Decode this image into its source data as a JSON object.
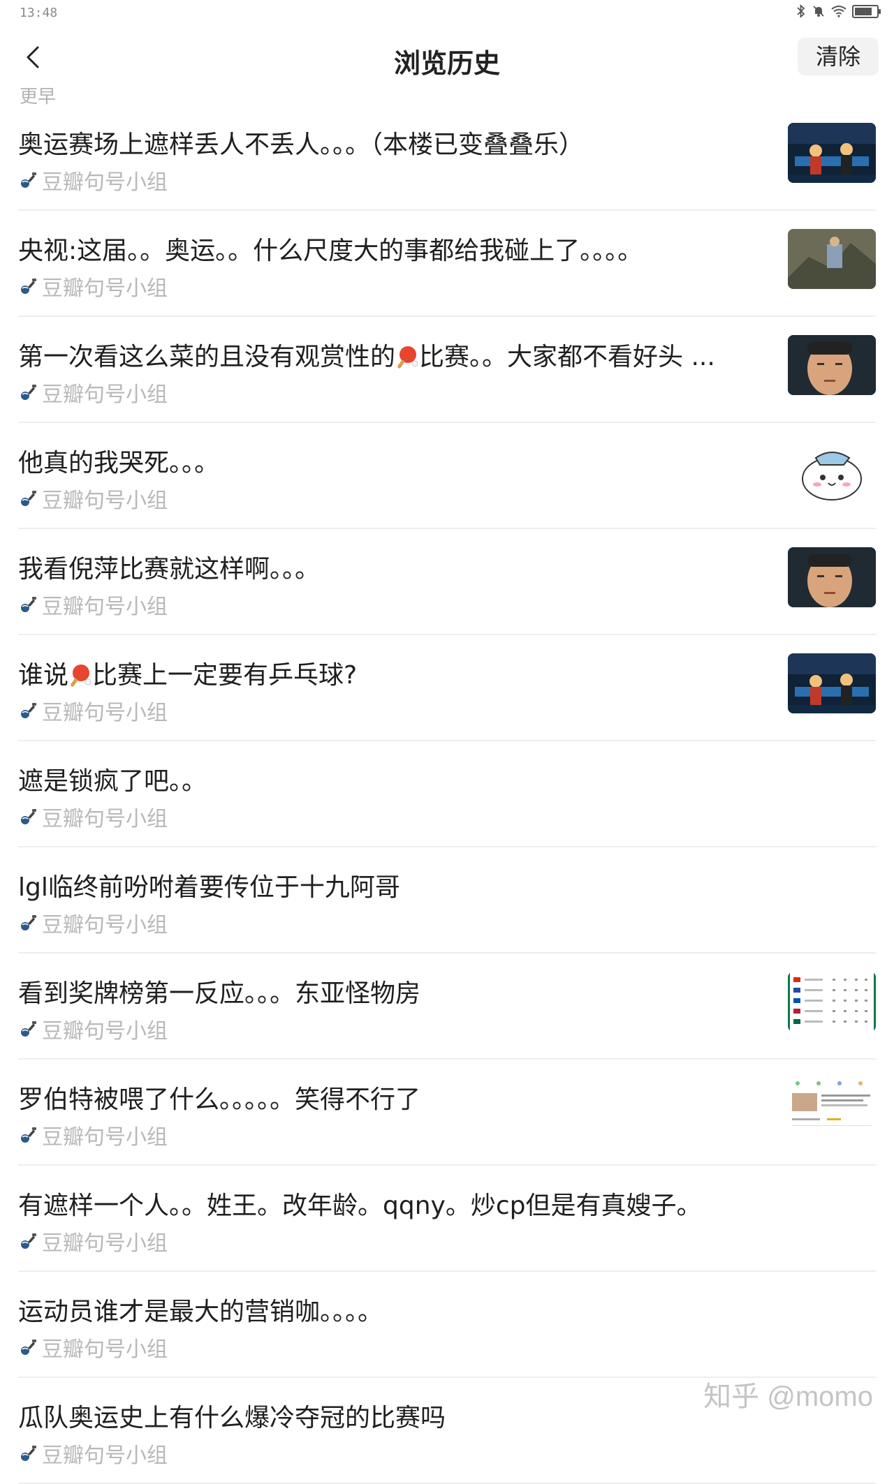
{
  "status_bar": {
    "time": "13:48",
    "icons": [
      "bluetooth-icon",
      "mute-icon",
      "wifi-icon",
      "battery-icon"
    ],
    "battery_level": 0.85
  },
  "header": {
    "title": "浏览历史",
    "clear_label": "清除",
    "back_icon": "back-arrow-icon"
  },
  "section_label": "更早",
  "items": [
    {
      "title": "奥运赛场上遮样丢人不丢人。。。（本楼已变叠叠乐）",
      "group": "豆瓣句号小组",
      "thumb": "table-tennis-match"
    },
    {
      "title": "央视:这届。。奥运。。什么尺度大的事都给我碰上了。。。。",
      "group": "豆瓣句号小组",
      "thumb": "rock-climbing"
    },
    {
      "title_before": "第一次看这么菜的且没有观赏性的",
      "title_after": "比赛。。大家都不看好头 ...",
      "group": "豆瓣句号小组",
      "thumb": "player-face"
    },
    {
      "title": "他真的我哭死。。。",
      "group": "豆瓣句号小组",
      "thumb": "cartoon-cat"
    },
    {
      "title": "我看倪萍比赛就这样啊。。。",
      "group": "豆瓣句号小组",
      "thumb": "player-face"
    },
    {
      "title_before": "谁说",
      "title_after": "比赛上一定要有乒乓球?",
      "group": "豆瓣句号小组",
      "thumb": "table-tennis-match"
    },
    {
      "title": "遮是锁疯了吧。。",
      "group": "豆瓣句号小组",
      "thumb": ""
    },
    {
      "title": "lgl临终前吩咐着要传位于十九阿哥",
      "group": "豆瓣句号小组",
      "thumb": ""
    },
    {
      "title": "看到奖牌榜第一反应。。。东亚怪物房",
      "group": "豆瓣句号小组",
      "thumb": "medal-table"
    },
    {
      "title": "罗伯特被喂了什么。。。。。笑得不行了",
      "group": "豆瓣句号小组",
      "thumb": "app-screenshot"
    },
    {
      "title": "有遮样一个人。。姓王。改年龄。qqny。炒cp但是有真嫂子。",
      "group": "豆瓣句号小组",
      "thumb": ""
    },
    {
      "title": "运动员谁才是最大的营销咖。。。。",
      "group": "豆瓣句号小组",
      "thumb": ""
    },
    {
      "title": "瓜队奥运史上有什么爆冷夺冠的比赛吗",
      "group": "豆瓣句号小组",
      "thumb": ""
    }
  ],
  "watermark": "知乎 @momo"
}
